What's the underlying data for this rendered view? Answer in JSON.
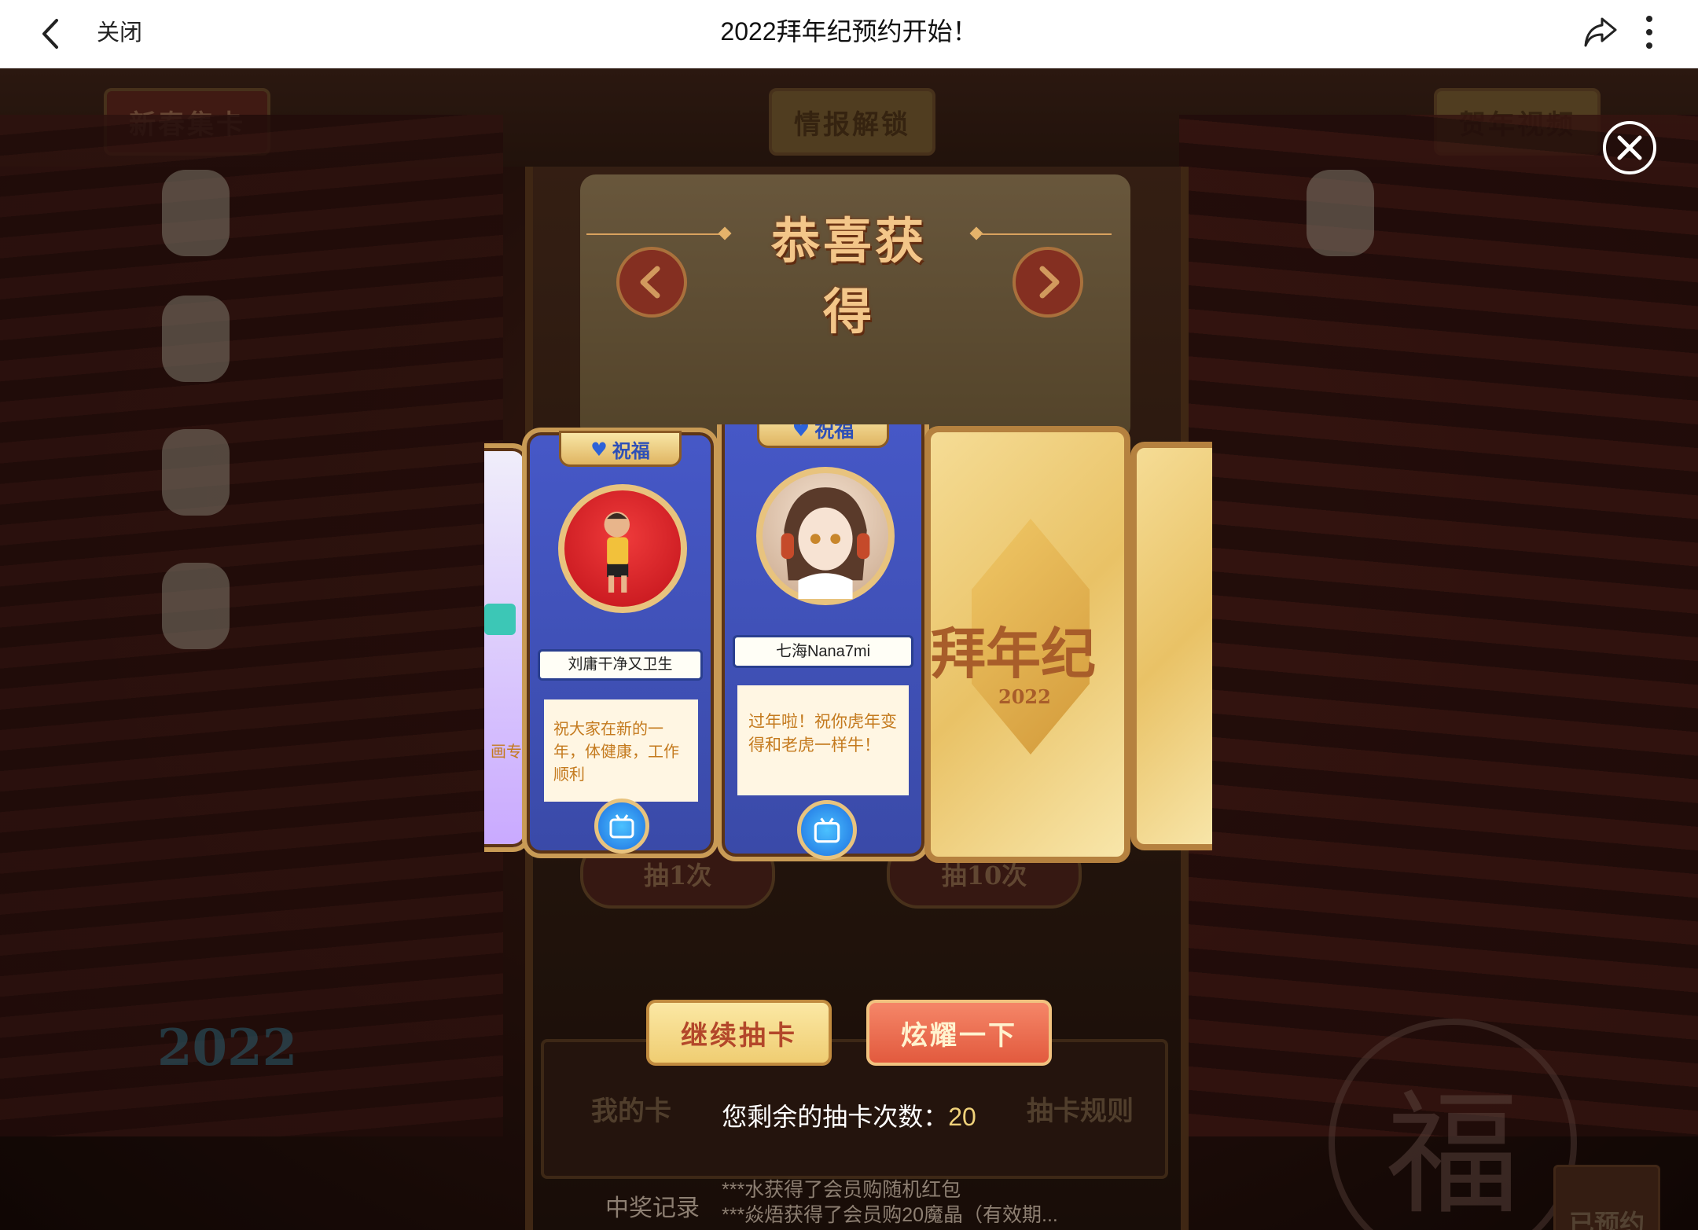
{
  "navbar": {
    "close_label": "关闭",
    "title": "2022拜年纪预约开始！",
    "icons": [
      "back-icon",
      "share-icon",
      "more-icon"
    ]
  },
  "background": {
    "tabs": [
      "新春集卡",
      "情报解锁",
      "贺年视频"
    ],
    "machine_buttons": [
      "抽1次",
      "抽10次"
    ],
    "machine_labels": [
      "我的卡",
      "抽卡规则"
    ],
    "neon_text": "2022",
    "seal_char": "福",
    "reserved_label": "已预约",
    "record_label": "中奖记录",
    "records": [
      "***水获得了会员购随机红包",
      "***焱焐获得了会员购20魔晶（有效期..."
    ]
  },
  "modal": {
    "title": "恭喜获得",
    "cards": [
      {
        "tag": "祝福",
        "name": "刘庸干净又卫生",
        "message": "祝大家在新的一年，体健康，工作顺利"
      },
      {
        "tag": "祝福",
        "name": "七海Nana7mi",
        "message": "过年啦！祝你虎年变得和老虎一样牛！"
      }
    ],
    "partial_left_text": "画专",
    "card_back_text": "拜年纪",
    "card_back_year": "2022",
    "continue_button": "继续抽卡",
    "show_off_button": "炫耀一下",
    "remaining_label": "您剩余的抽卡次数：",
    "remaining_count": "20"
  },
  "colors": {
    "card_blue": "#4658c7",
    "gold": "#c99b55",
    "accent_yellow": "#f0d27a"
  }
}
